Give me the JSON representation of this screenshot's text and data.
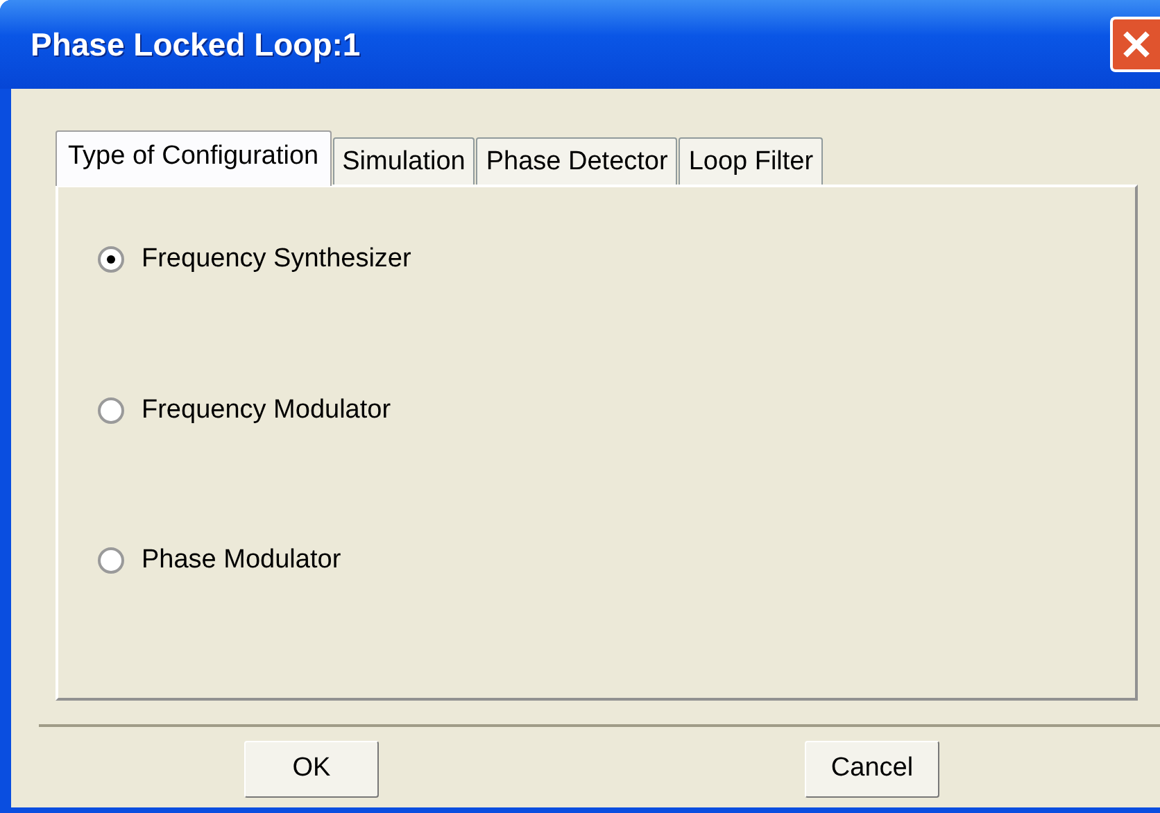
{
  "window": {
    "title": "Phase Locked Loop:1"
  },
  "tabs": [
    {
      "label": "Type of Configuration",
      "selected": true
    },
    {
      "label": "Simulation",
      "selected": false
    },
    {
      "label": "Phase Detector",
      "selected": false
    },
    {
      "label": "Loop Filter",
      "selected": false
    }
  ],
  "options": [
    {
      "label": "Frequency Synthesizer",
      "selected": true
    },
    {
      "label": "Frequency Modulator",
      "selected": false
    },
    {
      "label": "Phase Modulator",
      "selected": false
    }
  ],
  "buttons": [
    "OK",
    "Cancel"
  ]
}
